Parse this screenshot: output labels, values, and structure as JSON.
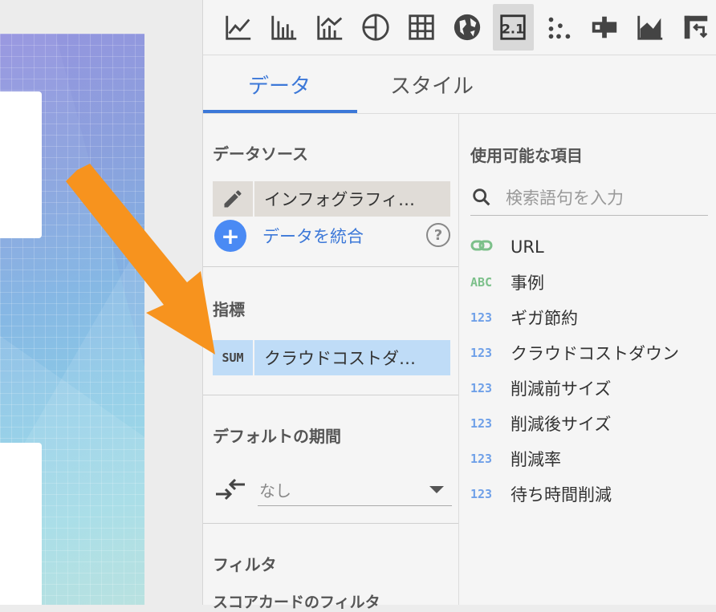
{
  "tabs": {
    "data": "データ",
    "style": "スタイル"
  },
  "data_source": {
    "title": "データソース",
    "name": "インフォグラフィ…",
    "blend_label": "データを統合",
    "help": "?"
  },
  "metric": {
    "title": "指標",
    "aggregation": "SUM",
    "name": "クラウドコストダ…"
  },
  "default_date": {
    "title": "デフォルトの期間",
    "value": "なし"
  },
  "filter": {
    "title": "フィルタ",
    "subtitle": "スコアカードのフィルタ"
  },
  "available_fields": {
    "title": "使用可能な項目",
    "search_placeholder": "検索語句を入力",
    "items": [
      {
        "type": "link",
        "label": "URL"
      },
      {
        "type": "ABC",
        "label": "事例"
      },
      {
        "type": "123",
        "label": "ギガ節約"
      },
      {
        "type": "123",
        "label": "クラウドコストダウン"
      },
      {
        "type": "123",
        "label": "削減前サイズ"
      },
      {
        "type": "123",
        "label": "削減後サイズ"
      },
      {
        "type": "123",
        "label": "削減率"
      },
      {
        "type": "123",
        "label": "待ち時間削減"
      }
    ]
  },
  "colors": {
    "accent": "#3c78d8",
    "arrow": "#f7931e",
    "metric_chip": "#bfdcf7",
    "source_chip": "#e0dcd7"
  },
  "toolbar_icons": [
    "time-series-icon",
    "bar-chart-icon",
    "combo-chart-icon",
    "pie-chart-icon",
    "table-icon",
    "geo-map-icon",
    "scorecard-icon",
    "scatter-chart-icon",
    "bullet-chart-icon",
    "area-chart-icon",
    "pivot-table-icon"
  ]
}
